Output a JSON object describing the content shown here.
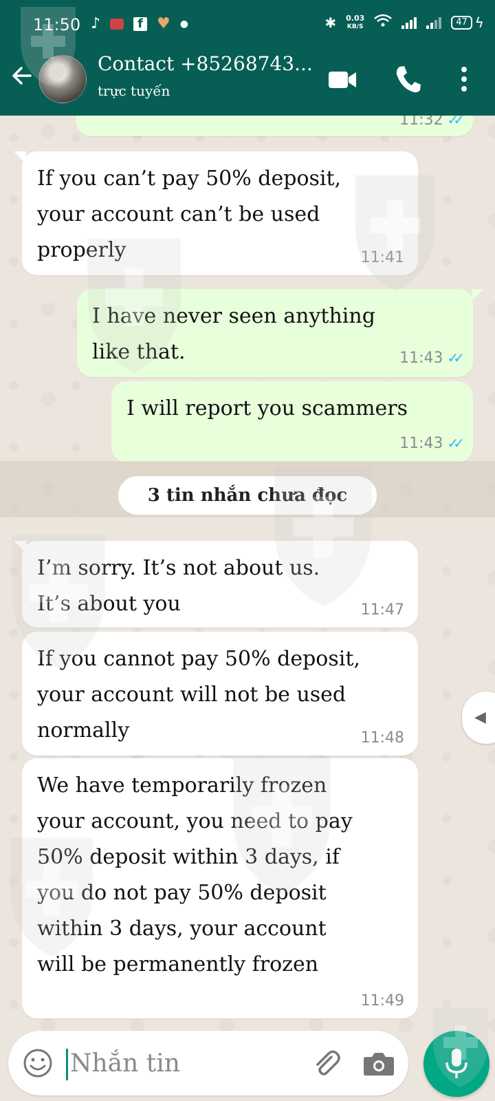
{
  "status_bar": {
    "time": "11:50",
    "net_speed_value": "0.03",
    "net_speed_unit": "KB/S",
    "battery": "47"
  },
  "header": {
    "contact_name": "Contact +85268743...",
    "contact_status": "trực tuyến"
  },
  "messages": [
    {
      "direction": "out",
      "text": "",
      "time": "11:32",
      "ticks": "✓✓"
    },
    {
      "direction": "in",
      "text": "If you can’t pay 50% deposit,\nyour account can’t be used\nproperly",
      "time": "11:41"
    },
    {
      "direction": "out",
      "text": "I have never seen anything\nlike that.",
      "time": "11:43",
      "ticks": "✓✓"
    },
    {
      "direction": "out",
      "text": "I will report you scammers",
      "time": "11:43",
      "ticks": "✓✓"
    },
    {
      "direction": "in",
      "text": "I’m sorry. It’s not about us.\nIt’s about you",
      "time": "11:47"
    },
    {
      "direction": "in",
      "text": "If you cannot pay 50% deposit,\nyour account will not be used\nnormally",
      "time": "11:48"
    },
    {
      "direction": "in",
      "text": "We have temporarily frozen\nyour account, you need to pay\n50% deposit within 3 days, if\nyou do not pay 50% deposit\nwithin 3 days, your account\nwill be permanently frozen",
      "time": "11:49"
    }
  ],
  "unread_banner": "3 tin nhắn chưa đọc",
  "composer": {
    "placeholder": "Nhắn tin"
  },
  "colors": {
    "header": "#075E54",
    "outgoing_bubble": "#E7FFDB",
    "incoming_bubble": "#FFFFFF",
    "read_ticks": "#34B7F1",
    "mic_button": "#00A884"
  }
}
